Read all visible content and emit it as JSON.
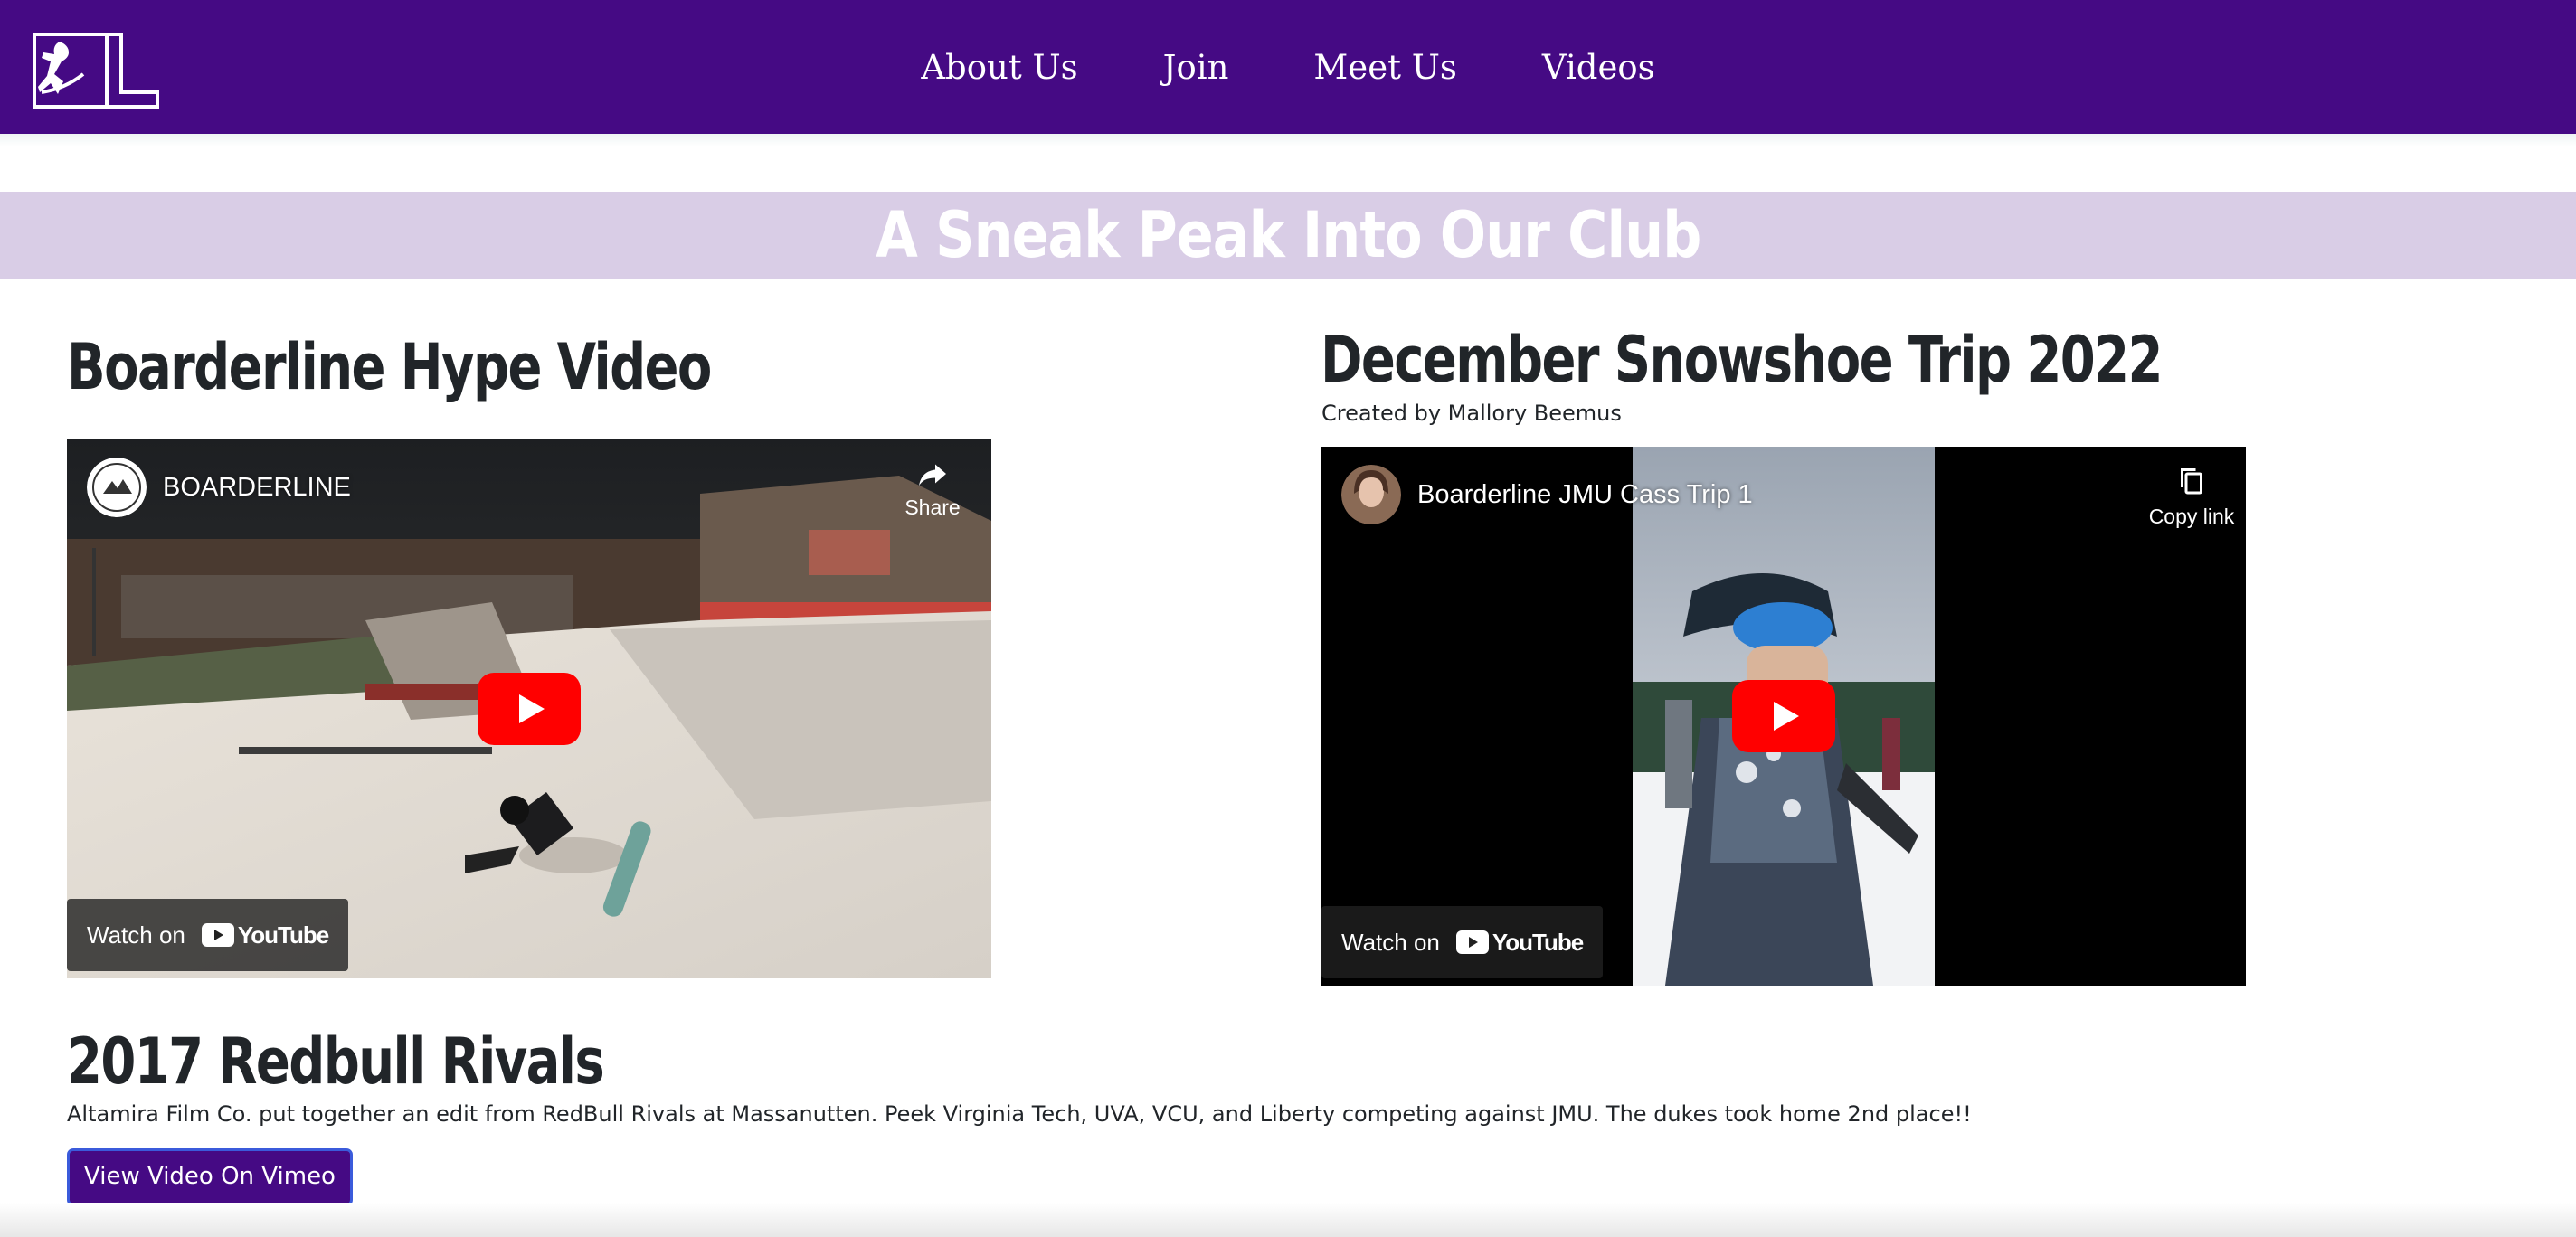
{
  "nav": {
    "logo_alt": "BL",
    "links": [
      "About Us",
      "Join",
      "Meet Us",
      "Videos"
    ]
  },
  "banner": {
    "title": "A Sneak Peak Into Our Club"
  },
  "sections": {
    "hype": {
      "heading": "Boarderline Hype Video",
      "video": {
        "channel": "BOARDERLINE",
        "corner_label": "Share",
        "watch_on": "Watch on",
        "youtube": "YouTube"
      }
    },
    "snowshoe": {
      "heading": "December Snowshoe Trip 2022",
      "caption": "Created by Mallory Beemus",
      "video": {
        "title": "Boarderline JMU Cass Trip 1",
        "corner_label": "Copy link",
        "watch_on": "Watch on",
        "youtube": "YouTube"
      }
    },
    "redbull": {
      "heading": "2017 Redbull Rivals",
      "description": "Altamira Film Co. put together an edit from RedBull Rivals at Massanutten. Peek Virginia Tech, UVA, VCU, and Liberty competing against JMU. The dukes took home 2nd place!!",
      "button": "View Video On Vimeo"
    }
  },
  "colors": {
    "nav_bg": "#450a84",
    "banner_bg": "#d9cde6",
    "youtube_red": "#ff0000"
  }
}
